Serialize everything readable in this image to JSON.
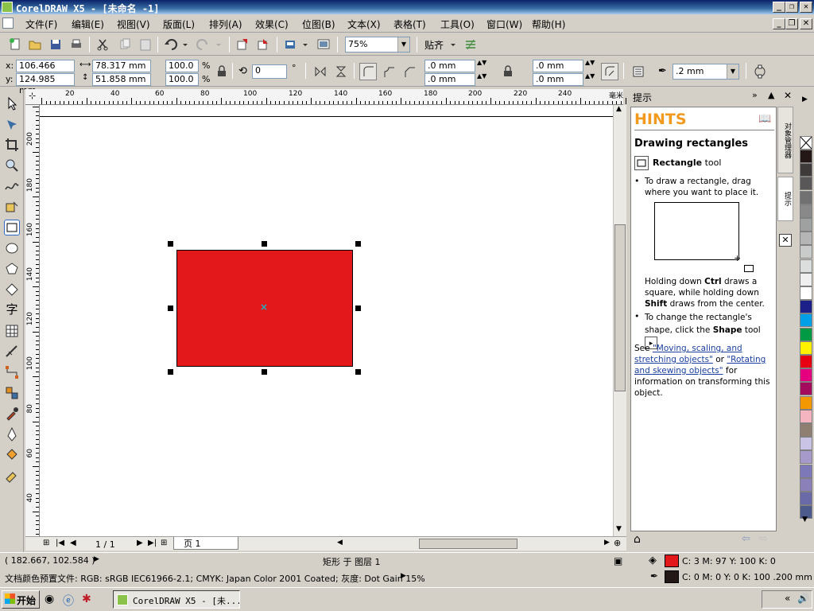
{
  "window": {
    "title": "CorelDRAW X5 - [未命名 -1]",
    "buttons": [
      "_",
      "❐",
      "✕"
    ]
  },
  "menu": [
    "文件(F)",
    "编辑(E)",
    "视图(V)",
    "版面(L)",
    "排列(A)",
    "效果(C)",
    "位图(B)",
    "文本(X)",
    "表格(T)",
    "工具(O)",
    "窗口(W)",
    "帮助(H)"
  ],
  "toolbar": {
    "zoom": "75%",
    "snap_label": "贴齐"
  },
  "propbar": {
    "x": "106.466 mm",
    "y": "124.985 mm",
    "width": "78.317 mm",
    "height": "51.858 mm",
    "scale_w": "100.0",
    "scale_h": "100.0",
    "pct": "%",
    "rotation": "0",
    "deg": "°",
    "corner1": ".0 mm",
    "corner2": ".0 mm",
    "corner3": ".0 mm",
    "corner4": ".0 mm",
    "outline": ".2 mm"
  },
  "ruler": {
    "h_labels": [
      "20",
      "40",
      "60",
      "80",
      "100",
      "120",
      "140",
      "160",
      "180",
      "200",
      "220",
      "240"
    ],
    "h_unit": "毫米",
    "v_labels": [
      "200",
      "180",
      "160",
      "140",
      "120",
      "100",
      "80",
      "60",
      "40"
    ]
  },
  "document": {
    "page_counter": "1 / 1",
    "page_tab": "页 1"
  },
  "shape": {
    "fill": "#e3181a"
  },
  "hints": {
    "tab_title": "提示",
    "heading": "HINTS",
    "title": "Drawing rectangles",
    "tool_name": "Rectangle",
    "tool_suffix": " tool",
    "bullet1": "To draw a rectangle, drag where you want to place it.",
    "para_a": "Holding down ",
    "ctrl": "Ctrl",
    "para_b": " draws a square, while holding down ",
    "shift": "Shift",
    "para_c": " draws from the center.",
    "bullet2a": "To change the rectangle's shape, click the ",
    "bullet2b": "Shape",
    "bullet2c": " tool",
    "see": "See ",
    "link1": "\"Moving, scaling, and stretching objects\"",
    "or": " or ",
    "link2": "\"Rotating and skewing objects\"",
    "after": " for information on transforming this object."
  },
  "docker_tabs": [
    "对象管理器",
    "提示"
  ],
  "status": {
    "coords": "( 182.667, 102.584 )",
    "object": "矩形 于 图层 1",
    "profile": "文档颜色预置文件: RGB: sRGB IEC61966-2.1; CMYK: Japan Color 2001 Coated; 灰度: Dot Gain 15%",
    "fill_info": "C: 3 M: 97 Y: 100 K: 0",
    "outline_info": "C: 0 M: 0 Y: 0 K: 100  .200 mm",
    "fill_color": "#e3181a",
    "outline_color": "#231815"
  },
  "taskbar": {
    "start": "开始",
    "task": "CorelDRAW X5 - [未..."
  },
  "palette": [
    "#231815",
    "#3e3a39",
    "#595757",
    "#727171",
    "#898989",
    "#9fa0a0",
    "#b5b5b6",
    "#c9caca",
    "#dcdddd",
    "#efefef",
    "#ffffff",
    "#1d2088",
    "#00a0e9",
    "#009944",
    "#fff100",
    "#e60012",
    "#e4007f",
    "#a40b5d",
    "#f39800",
    "#f4b4c0",
    "#8f7f73",
    "#c9c3e6",
    "#a59aca",
    "#7d78b8",
    "#8c80b8",
    "#6a6aa8",
    "#4c5a8c"
  ]
}
